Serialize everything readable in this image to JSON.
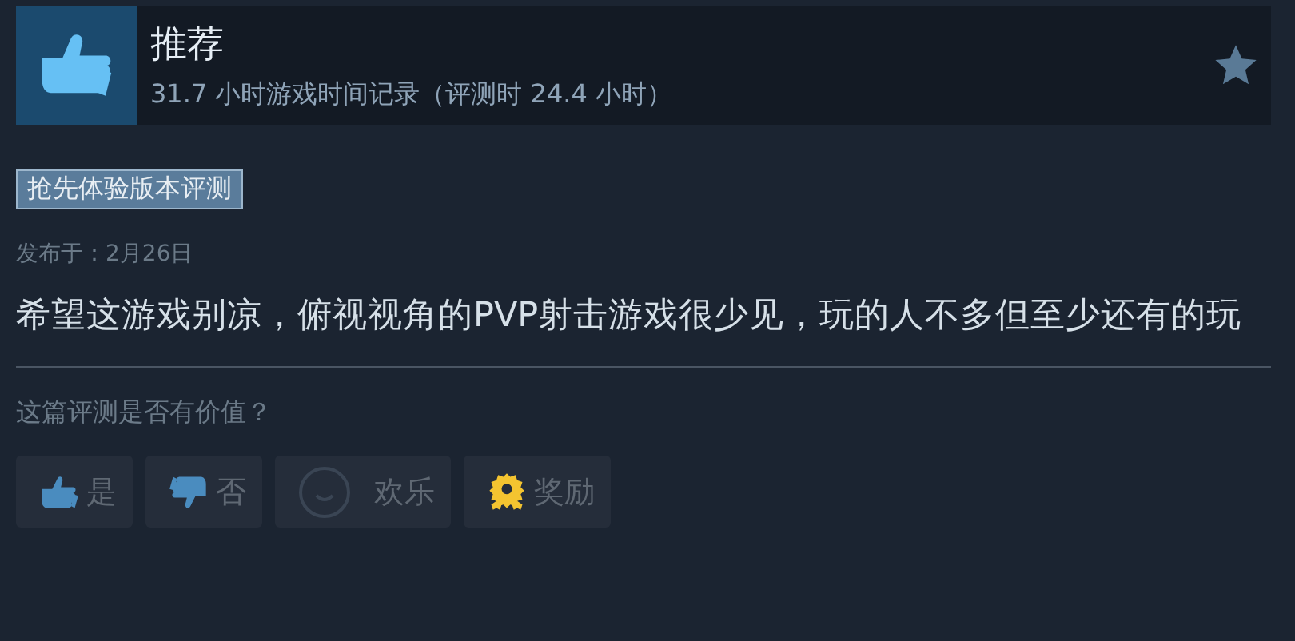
{
  "header": {
    "title": "推荐",
    "playtime": "31.7 小时游戏时间记录（评测时 24.4 小时）"
  },
  "tag": "抢先体验版本评测",
  "posted": "发布于：2月26日",
  "review_text": "希望这游戏别凉，俯视视角的PVP射击游戏很少见，玩的人不多但至少还有的玩",
  "question": "这篇评测是否有价值？",
  "buttons": [
    {
      "kind": "thumbs-up",
      "label": "是"
    },
    {
      "kind": "thumbs-down",
      "label": "否"
    },
    {
      "kind": "smile",
      "label": "欢乐"
    },
    {
      "kind": "award",
      "label": "奖励"
    }
  ]
}
